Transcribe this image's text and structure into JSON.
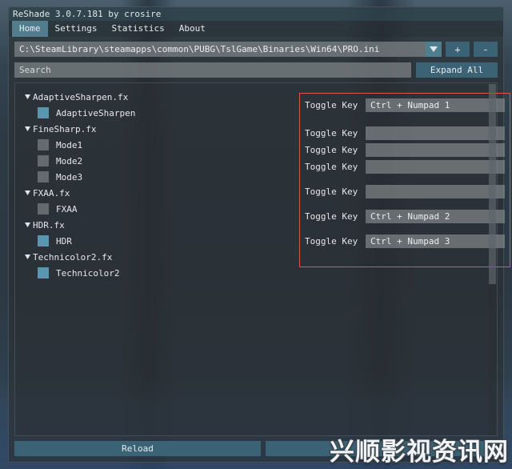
{
  "window": {
    "title": "ReShade 3.0.7.181 by crosire",
    "tabs": [
      {
        "label": "Home",
        "active": true
      },
      {
        "label": "Settings",
        "active": false
      },
      {
        "label": "Statistics",
        "active": false
      },
      {
        "label": "About",
        "active": false
      }
    ]
  },
  "preset": {
    "path_value": "C:\\SteamLibrary\\steamapps\\common\\PUBG\\TslGame\\Binaries\\Win64\\PRO.ini",
    "dropdown_icon": "chevron-down-icon",
    "add_label": "+",
    "remove_label": "-"
  },
  "search": {
    "placeholder": "Search",
    "value": "",
    "expand_all_label": "Expand All"
  },
  "effects": {
    "groups": [
      {
        "file": "AdaptiveSharpen.fx",
        "expanded": true,
        "techniques": [
          {
            "name": "AdaptiveSharpen",
            "enabled": true
          }
        ]
      },
      {
        "file": "FineSharp.fx",
        "expanded": true,
        "techniques": [
          {
            "name": "Mode1",
            "enabled": false
          },
          {
            "name": "Mode2",
            "enabled": false
          },
          {
            "name": "Mode3",
            "enabled": false
          }
        ]
      },
      {
        "file": "FXAA.fx",
        "expanded": true,
        "techniques": [
          {
            "name": "FXAA",
            "enabled": false
          }
        ]
      },
      {
        "file": "HDR.fx",
        "expanded": true,
        "techniques": [
          {
            "name": "HDR",
            "enabled": true
          }
        ]
      },
      {
        "file": "Technicolor2.fx",
        "expanded": true,
        "techniques": [
          {
            "name": "Technicolor2",
            "enabled": true
          }
        ]
      }
    ]
  },
  "toggle_keys": {
    "highlight_color": "#e0564a",
    "rows": [
      {
        "label": "Toggle Key",
        "value": "Ctrl + Numpad 1"
      },
      {
        "label": "Toggle Key",
        "value": ""
      },
      {
        "label": "Toggle Key",
        "value": ""
      },
      {
        "label": "Toggle Key",
        "value": ""
      },
      {
        "label": "Toggle Key",
        "value": ""
      },
      {
        "label": "Toggle Key",
        "value": "Ctrl + Numpad 2"
      },
      {
        "label": "Toggle Key",
        "value": "Ctrl + Numpad 3"
      }
    ]
  },
  "footer": {
    "reload_label": "Reload",
    "edit_label": ""
  },
  "watermark": {
    "text": "兴顺影视资讯网",
    "sub": ""
  },
  "theme": {
    "accent": "#5d90a3",
    "field_bg": "#808588",
    "panel_bg": "#292e32",
    "text": "#e3e9ec",
    "checkbox_on": "#5ca0ba"
  }
}
